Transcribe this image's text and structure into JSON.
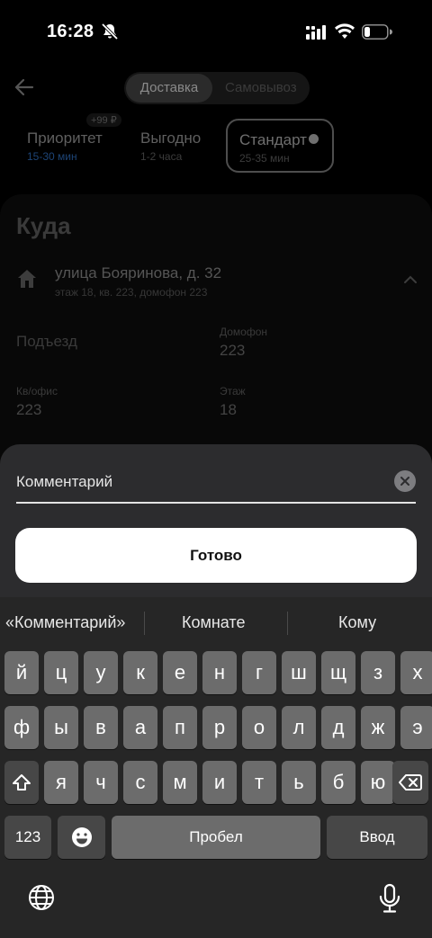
{
  "status": {
    "time": "16:28"
  },
  "header": {
    "tabs": [
      {
        "label": "Доставка",
        "active": true
      },
      {
        "label": "Самовывоз",
        "active": false
      }
    ]
  },
  "tariffs": [
    {
      "name": "Приоритет",
      "eta": "15-30 мин",
      "badge": "+99 ₽"
    },
    {
      "name": "Выгодно",
      "eta": "1-2 часа"
    },
    {
      "name": "Стандарт",
      "eta": "25-35 мин",
      "selected": true
    }
  ],
  "destination": {
    "heading": "Куда",
    "address": "улица Бояринова, д. 32",
    "address_details": "этаж 18, кв. 223, домофон 223",
    "entrance_label": "Подъезд",
    "intercom_label": "Домофон",
    "intercom_value": "223",
    "apt_label": "Кв/офис",
    "apt_value": "223",
    "floor_label": "Этаж",
    "floor_value": "18"
  },
  "sheet": {
    "comment_placeholder": "Комментарий",
    "done_label": "Готово"
  },
  "keyboard": {
    "suggestions": [
      "«Комментарий»",
      "Комнате",
      "Кому"
    ],
    "row1": [
      "й",
      "ц",
      "у",
      "к",
      "е",
      "н",
      "г",
      "ш",
      "щ",
      "з",
      "х"
    ],
    "row2": [
      "ф",
      "ы",
      "в",
      "а",
      "п",
      "р",
      "о",
      "л",
      "д",
      "ж",
      "э"
    ],
    "row3": [
      "я",
      "ч",
      "с",
      "м",
      "и",
      "т",
      "ь",
      "б",
      "ю"
    ],
    "numbers_label": "123",
    "space_label": "Пробел",
    "return_label": "Ввод"
  },
  "colors": {
    "sheet_bg": "#2c2c2e",
    "key_light": "#6c6c6c",
    "key_dark": "#474747",
    "done_bg": "#ffffff",
    "eta_blue": "#1d4476"
  }
}
